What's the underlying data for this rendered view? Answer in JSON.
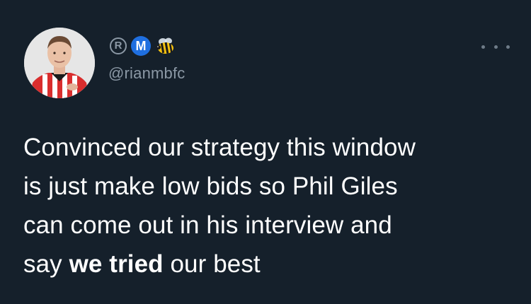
{
  "tweet": {
    "display_name_icons": [
      "registered-icon",
      "m-badge-icon",
      "bee-emoji-icon"
    ],
    "m_badge_label": "M",
    "registered_label": "R",
    "handle": "@rianmbfc",
    "more_label": "...",
    "text": {
      "line1": "Convinced our strategy this window",
      "line2": "is just make low bids so Phil Giles",
      "line3": "can come out in his interview and",
      "line4_before": "say ",
      "line4_bold": "we tried",
      "line4_after": " our best"
    }
  },
  "colors": {
    "background": "#15202b",
    "text": "#ffffff",
    "secondary_text": "#8b98a5",
    "m_badge": "#1f6fe0"
  }
}
